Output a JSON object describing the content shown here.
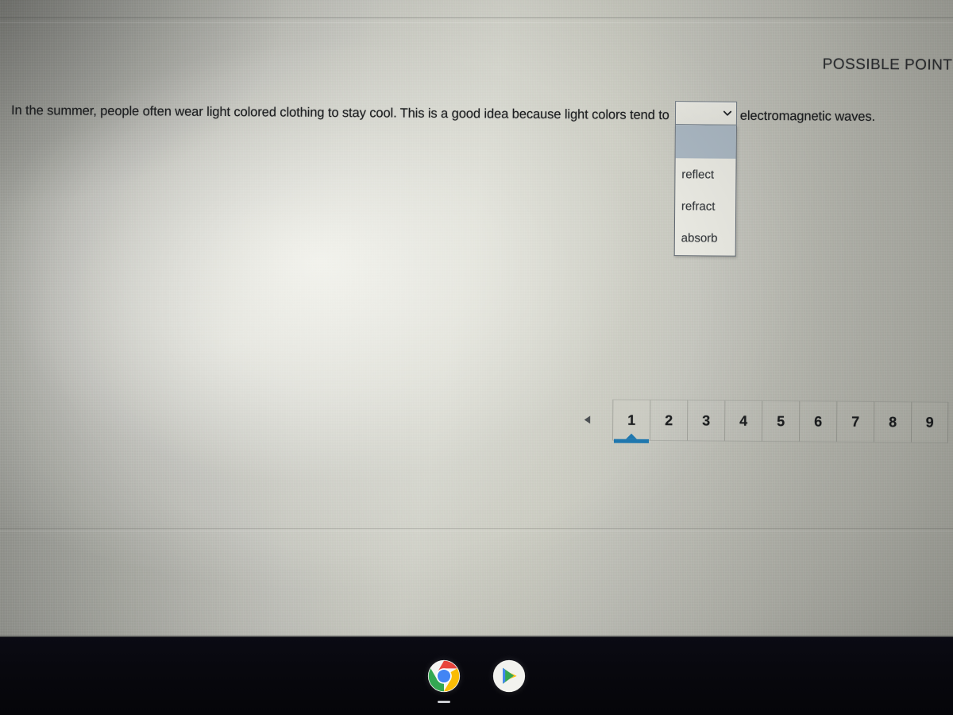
{
  "header": {
    "possible_points_label": "POSSIBLE POINTS"
  },
  "question": {
    "text_before": "In the summer, people often wear light colored clothing to stay cool.",
    "text_middle": "This is a good idea because light colors tend to",
    "text_after": "electromagnetic waves."
  },
  "answer_select": {
    "name": "answer-dropdown",
    "selected_value": "",
    "expanded": true,
    "chevron_icon": "chevron-down-icon",
    "options": [
      {
        "label": "",
        "highlighted": true
      },
      {
        "label": "reflect",
        "highlighted": false
      },
      {
        "label": "refract",
        "highlighted": false
      },
      {
        "label": "absorb",
        "highlighted": false
      }
    ]
  },
  "pagination": {
    "prev_icon": "triangle-left-icon",
    "active_page": "1",
    "accent_color": "#1f77ae",
    "pages": [
      "1",
      "2",
      "3",
      "4",
      "5",
      "6",
      "7",
      "8",
      "9"
    ]
  },
  "taskbar": {
    "items": [
      {
        "icon": "chrome-icon",
        "label": "Chrome",
        "running": true
      },
      {
        "icon": "google-play-icon",
        "label": "Play Store",
        "running": false
      }
    ]
  },
  "colors": {
    "accent_blue": "#1f77ae",
    "dropdown_highlight": "#a9b6c1",
    "select_border": "#707a84",
    "text": "#1c1e20",
    "taskbar_bg": "#08080e"
  }
}
